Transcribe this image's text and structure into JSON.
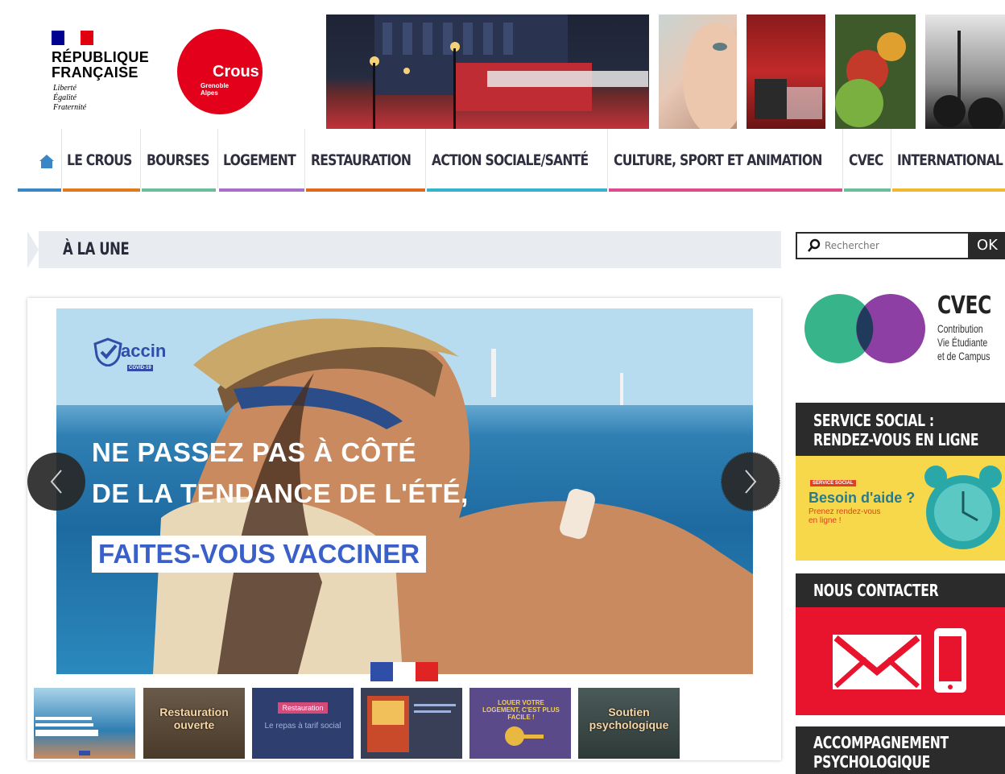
{
  "header": {
    "rf_lines": [
      "RÉPUBLIQUE",
      "FRANÇAISE"
    ],
    "rf_motto": [
      "Liberté",
      "Égalité",
      "Fraternité"
    ],
    "crous_word": "Crous",
    "crous_sub": [
      "Grenoble",
      "Alpes"
    ]
  },
  "nav": {
    "home_icon": "home-icon",
    "items": [
      {
        "label": "LE CROUS",
        "color": "#e07a1f"
      },
      {
        "label": "BOURSES",
        "color": "#6abf98"
      },
      {
        "label": "LOGEMENT",
        "color": "#a770c7"
      },
      {
        "label": "RESTAURATION",
        "color": "#e0681f"
      },
      {
        "label": "ACTION SOCIALE/SANTÉ",
        "color": "#37b2cd"
      },
      {
        "label": "CULTURE, SPORT ET ANIMATION",
        "color": "#e04a8c"
      },
      {
        "label": "CVEC",
        "color": "#6abf98"
      },
      {
        "label": "INTERNATIONAL",
        "color": "#f0b732"
      }
    ],
    "home_color": "#3a87c8"
  },
  "main": {
    "section_title": "À LA UNE",
    "slide": {
      "badge_word": "accin",
      "badge_tag": "COVID-19",
      "line1": "NE PASSEZ PAS À CÔTÉ",
      "line2": "DE LA TENDANCE DE L'ÉTÉ,",
      "cta": "FAITES-VOUS VACCINER"
    },
    "thumbs": [
      {
        "label": "",
        "bg": "#5aa8d6"
      },
      {
        "label": "Restauration ouverte",
        "bg": "#5b4a3a"
      },
      {
        "label": "Restauration",
        "bg": "#2e3e6e"
      },
      {
        "label": "",
        "bg": "#3a3f58"
      },
      {
        "label": "",
        "bg": "#5b4a8a"
      },
      {
        "label": "Soutien psychologique",
        "bg": "#40524f"
      }
    ],
    "thumb3_sub": "Le repas à tarif social",
    "thumb5_sub": "LOUER VOTRE LOGEMENT, C'EST PLUS FACILE !"
  },
  "sidebar": {
    "search_placeholder": "Rechercher",
    "ok_label": "OK",
    "cvec_title": "CVEC",
    "cvec_sub": [
      "Contribution",
      "Vie Étudiante",
      "et de Campus"
    ],
    "card1_title": [
      "SERVICE SOCIAL :",
      "RENDEZ-VOUS EN LIGNE"
    ],
    "card1_tag": "SERVICE SOCIAL",
    "card1_big": "Besoin d'aide ?",
    "card1_small": [
      "Prenez rendez-vous",
      "en ligne !"
    ],
    "card2_title": "NOUS CONTACTER",
    "card3_title": [
      "ACCOMPAGNEMENT",
      "PSYCHOLOGIQUE"
    ]
  }
}
